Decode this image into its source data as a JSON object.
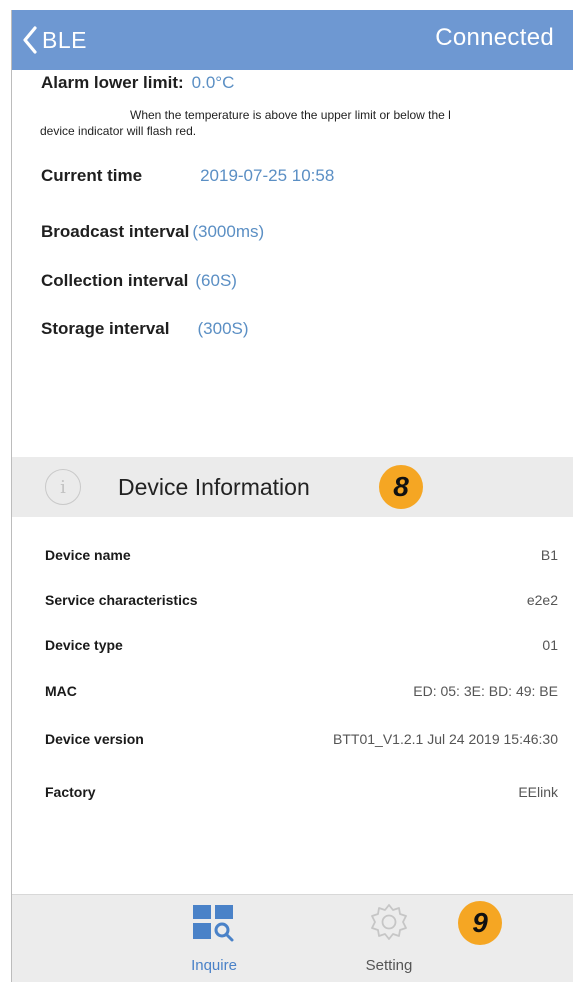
{
  "header": {
    "back_label": "BLE",
    "status": "Connected"
  },
  "settings": {
    "alarm_lower_label": "Alarm lower limit:",
    "alarm_lower_value": "0.0°C",
    "alarm_note_line1": "When the temperature is above the upper limit or below the l",
    "alarm_note_line2": "device indicator will flash red.",
    "current_time_label": "Current time",
    "current_time_value": "2019-07-25 10:58",
    "broadcast_label": "Broadcast interval",
    "broadcast_value": "(3000ms)",
    "collection_label": "Collection interval",
    "collection_value": "(60S)",
    "storage_label": "Storage interval",
    "storage_value": "(300S)"
  },
  "device_info": {
    "title": "Device Information",
    "badge": "8",
    "rows": [
      {
        "key": "Device name",
        "value": "B1"
      },
      {
        "key": "Service characteristics",
        "value": "e2e2"
      },
      {
        "key": "Device type",
        "value": "01"
      },
      {
        "key": "MAC",
        "value": "ED: 05: 3E: BD: 49: BE"
      },
      {
        "key": "Device version",
        "value": "BTT01_V1.2.1 Jul 24 2019 15:46:30"
      },
      {
        "key": "Factory",
        "value": "EElink"
      }
    ]
  },
  "tabbar": {
    "inquire_label": "Inquire",
    "setting_label": "Setting",
    "badge": "9",
    "active_color": "#4a82c8"
  },
  "colors": {
    "header_bg": "#6e98d2",
    "value_blue": "#5b8fc4",
    "badge_orange": "#f5a623"
  }
}
